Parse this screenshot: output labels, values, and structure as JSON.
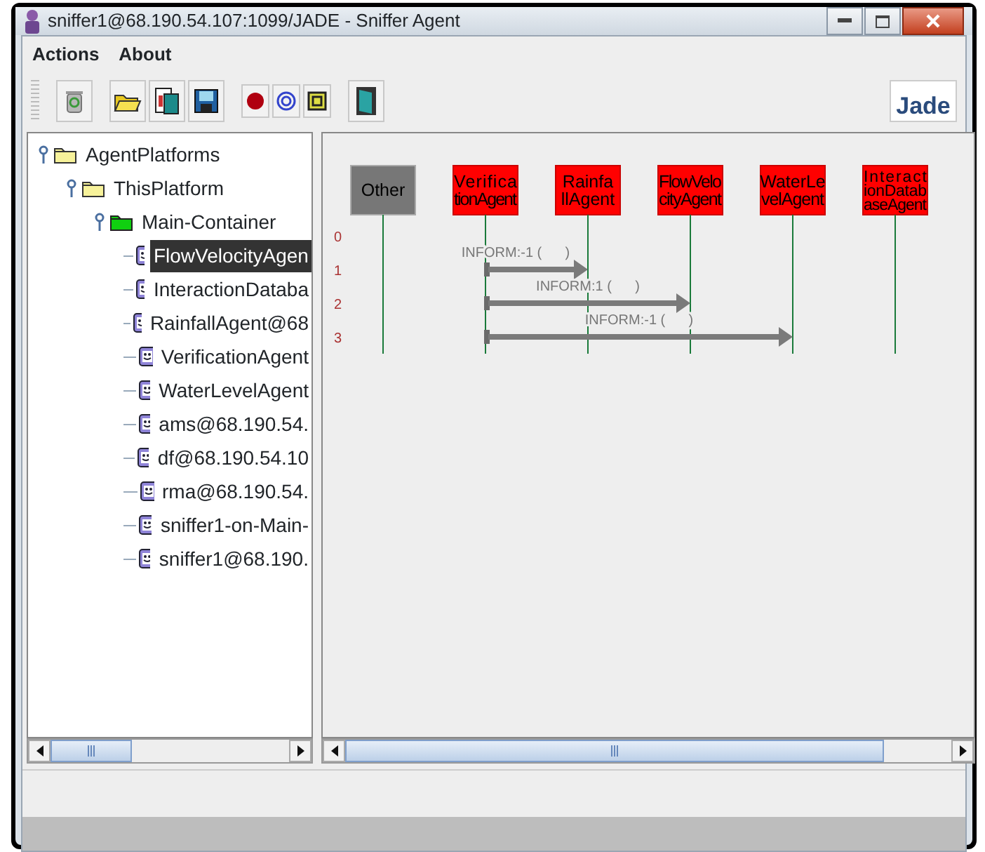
{
  "window": {
    "title": "sniffer1@68.190.54.107:1099/JADE - Sniffer Agent"
  },
  "menu": [
    "Actions",
    "About"
  ],
  "toolbar": {
    "logo": "Jade"
  },
  "tree": {
    "label": "AgentPlatforms",
    "kind": "folder",
    "expanded": true,
    "children": [
      {
        "label": "ThisPlatform",
        "kind": "folder",
        "expanded": true,
        "children": [
          {
            "label": "Main-Container",
            "kind": "container",
            "expanded": true,
            "children": [
              {
                "label": "FlowVelocityAgen",
                "kind": "agent",
                "selected": true
              },
              {
                "label": "InteractionDataba",
                "kind": "agent",
                "selected": false
              },
              {
                "label": "RainfallAgent@68",
                "kind": "agent",
                "selected": false
              },
              {
                "label": "VerificationAgent",
                "kind": "agent",
                "selected": false
              },
              {
                "label": "WaterLevelAgent",
                "kind": "agent",
                "selected": false
              },
              {
                "label": "ams@68.190.54.",
                "kind": "agent",
                "selected": false
              },
              {
                "label": "df@68.190.54.10",
                "kind": "agent",
                "selected": false
              },
              {
                "label": "rma@68.190.54.",
                "kind": "agent",
                "selected": false
              },
              {
                "label": "sniffer1-on-Main-",
                "kind": "agent",
                "selected": false
              },
              {
                "label": "sniffer1@68.190.",
                "kind": "agent",
                "selected": false
              }
            ]
          }
        ]
      }
    ]
  },
  "diagram": {
    "agents": [
      {
        "lines": [
          "Other"
        ],
        "kind": "other"
      },
      {
        "lines": [
          "Verifica",
          "tionAgent"
        ],
        "kind": "sniffed"
      },
      {
        "lines": [
          "Rainfa",
          "llAgent"
        ],
        "kind": "sniffed"
      },
      {
        "lines": [
          "FlowVelo",
          "cityAgent"
        ],
        "kind": "sniffed"
      },
      {
        "lines": [
          "WaterLe",
          "velAgent"
        ],
        "kind": "sniffed"
      },
      {
        "lines": [
          "Interact",
          "ionDatab",
          "aseAgent"
        ],
        "kind": "sniffed"
      }
    ],
    "rows": [
      "0",
      "1",
      "2",
      "3"
    ],
    "messages": [
      {
        "label": "INFORM:-1 (      )"
      },
      {
        "label": "INFORM:1 (      )"
      },
      {
        "label": "INFORM:-1 (      )"
      }
    ]
  }
}
